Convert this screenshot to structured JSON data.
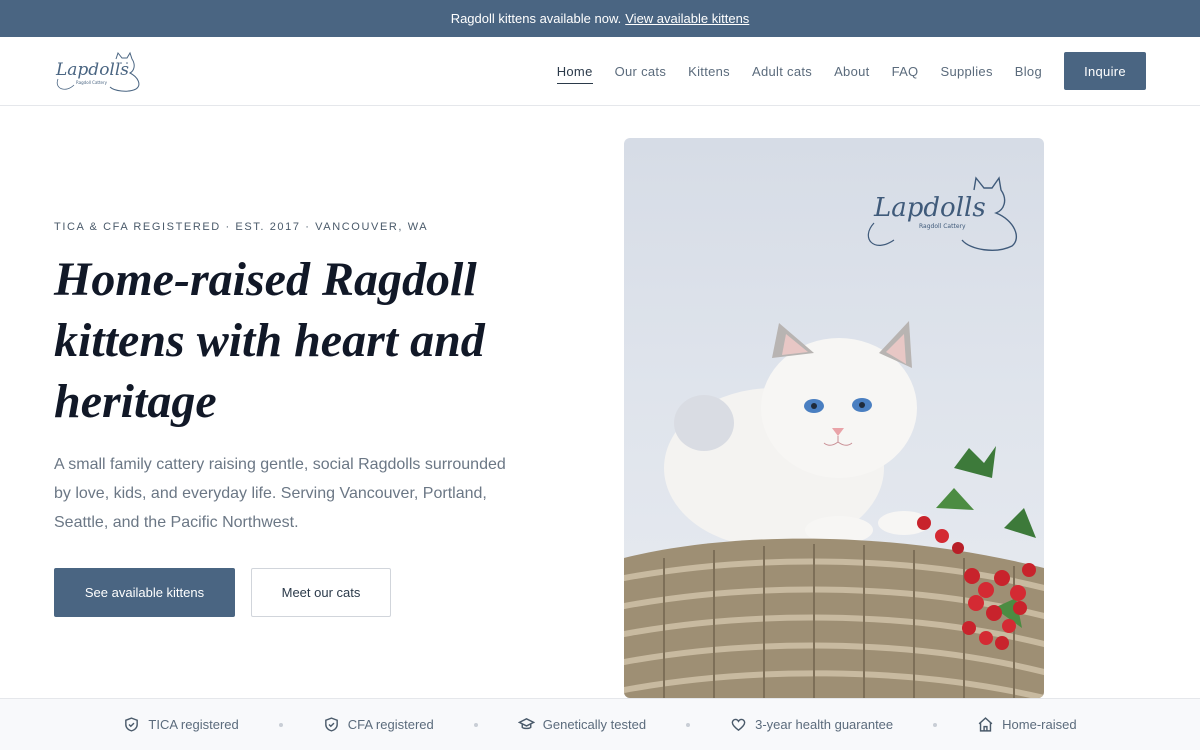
{
  "announcement": {
    "text": "Ragdoll kittens available now.",
    "link": "View available kittens"
  },
  "brand": {
    "logo_text": "Lapdolls",
    "logo_subtext": "Ragdoll Cattery"
  },
  "nav": {
    "items": [
      "Home",
      "Our cats",
      "Kittens",
      "Adult cats",
      "About",
      "FAQ",
      "Supplies",
      "Blog"
    ],
    "active": "Home",
    "cta": "Inquire"
  },
  "hero": {
    "eyebrow": "TICA & CFA REGISTERED · EST. 2017 · VANCOUVER, WA",
    "headline": "Home-raised Ragdoll kittens with heart and heritage",
    "subtext": "A small family cattery raising gentle, social Ragdolls surrounded by love, kids, and everyday life. Serving Vancouver, Portland, Seattle, and the Pacific Northwest.",
    "primary_button": "See available kittens",
    "secondary_button": "Meet our cats"
  },
  "trust": {
    "items": [
      {
        "label": "TICA registered",
        "icon": "shield-check-icon"
      },
      {
        "label": "CFA registered",
        "icon": "shield-check-icon"
      },
      {
        "label": "Genetically tested",
        "icon": "graduation-cap-icon"
      },
      {
        "label": "3-year health guarantee",
        "icon": "heart-icon"
      },
      {
        "label": "Home-raised",
        "icon": "house-icon"
      }
    ]
  },
  "colors": {
    "accent": "#4a6582",
    "text_dark": "#111827",
    "text_muted": "#6b7785"
  }
}
